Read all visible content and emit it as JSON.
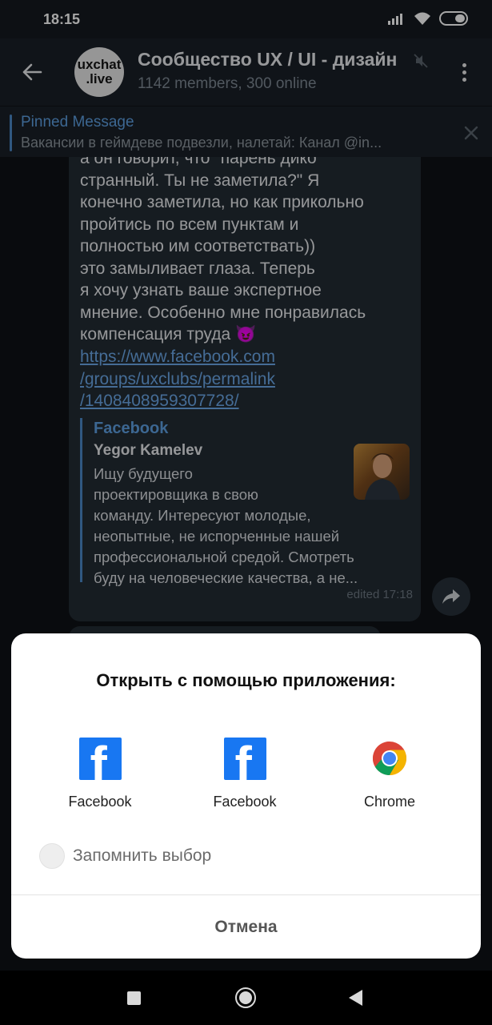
{
  "status_bar": {
    "time": "18:15"
  },
  "app_bar": {
    "avatar_line1": "uxchat",
    "avatar_line2": ".live",
    "title": "Сообщество UX / UI - дизайн",
    "subtitle": "1142 members, 300 online"
  },
  "pinned": {
    "title": "Pinned Message",
    "text": "Вакансии в геймдеве подвезли, налетай:  Канал @in..."
  },
  "message": {
    "text": "а он говорит, что \"парень дико\nстранный. Ты не заметила?\" Я\nконечно заметила, но как прикольно\nпройтись по всем пунктам и\nполностью им соответствать))\nэто замыливает глаза. Теперь\nя хочу узнать ваше экспертное\nмнение. Особенно мне понравилась\nкомпенсация труда 😈",
    "link": "https://www.facebook.com\n/groups/uxclubs/permalink\n/1408408959307728/",
    "preview": {
      "site": "Facebook",
      "author": "Yegor Kamelev",
      "text": "Ищу будущего\nпроектировщика в свою\nкоманду. Интересуют молодые,\nнеопытные, не испорченные нашей\nпрофессиональной средой. Смотреть\nбуду на человеческие качества, а не..."
    },
    "meta": "edited 17:18"
  },
  "dialog": {
    "title": "Открыть с помощью приложения:",
    "apps": [
      {
        "label": "Facebook",
        "icon": "facebook-icon"
      },
      {
        "label": "Facebook",
        "icon": "facebook-icon"
      },
      {
        "label": "Chrome",
        "icon": "chrome-icon"
      }
    ],
    "remember_label": "Запомнить выбор",
    "cancel_label": "Отмена"
  },
  "colors": {
    "accent": "#5d9ee0",
    "facebook": "#1877f2",
    "bubble": "#232b33"
  }
}
